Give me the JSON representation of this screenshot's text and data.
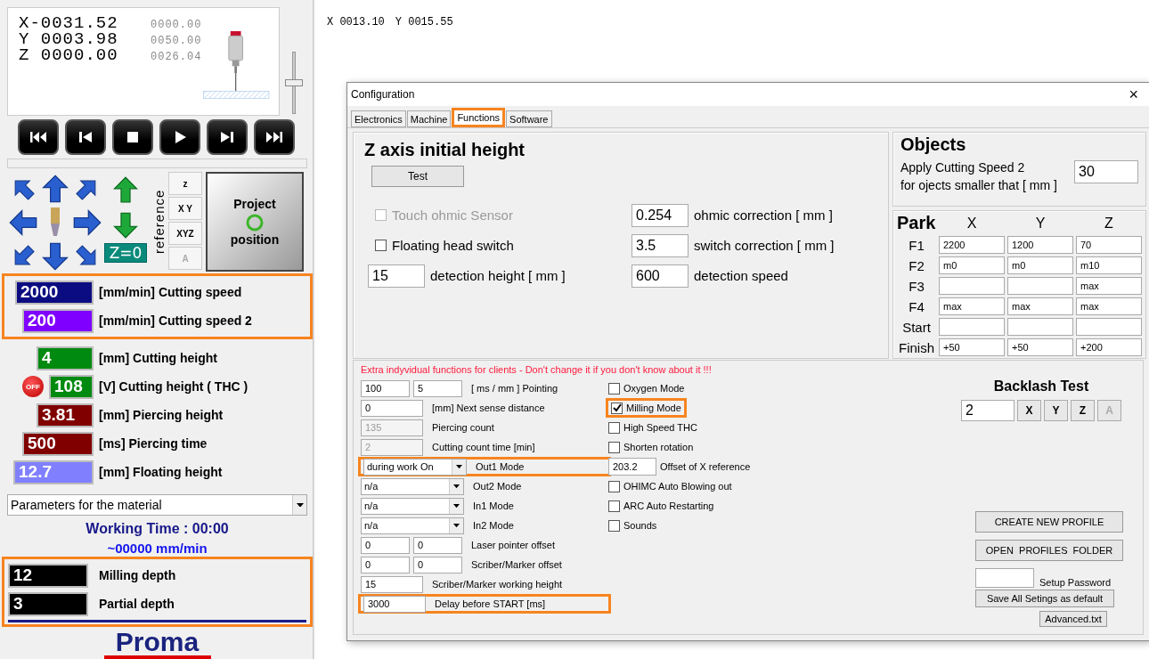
{
  "dro": {
    "axes": [
      {
        "position": "X-0031.52",
        "machine": "0000.00"
      },
      {
        "position": "Y 0003.98",
        "machine": "0050.00"
      },
      {
        "position": "Z 0000.00",
        "machine": "0026.04"
      }
    ]
  },
  "feed_slider": {
    "level": 0.5
  },
  "progress": {
    "level": 0
  },
  "jog": {
    "zero_button": "Z=0",
    "reference_label": "reference",
    "reference_buttons": [
      {
        "label": "z",
        "disabled": false
      },
      {
        "label": "X Y",
        "disabled": false
      },
      {
        "label": "XYZ",
        "disabled": false
      },
      {
        "label": "A",
        "disabled": true
      }
    ],
    "project_button": "Project position"
  },
  "parameter_groups": [
    {
      "highlighted": true,
      "rows": [
        {
          "value": "2000",
          "label": "[mm/min] Cutting speed",
          "color": "#0c0c82"
        },
        {
          "value": "200",
          "label": "[mm/min] Cutting speed 2",
          "color": "#8000ff"
        }
      ]
    },
    {
      "highlighted": false,
      "rows": [
        {
          "value": "4",
          "label": "[mm] Cutting height",
          "color": "#008a10"
        },
        {
          "value": "108",
          "label": "[V] Cutting height ( THC )",
          "color": "#008a10",
          "badge": "OFF"
        },
        {
          "value": "3.81",
          "label": "[mm] Piercing height",
          "color": "#800000"
        },
        {
          "value": "500",
          "label": "[ms] Piercing time",
          "color": "#800000"
        },
        {
          "value": "12.7",
          "label": "[mm] Floating height",
          "color": "#8080ff"
        }
      ]
    }
  ],
  "material_dropdown": "Parameters for the material",
  "working_time": "Working Time : 00:00",
  "speed_estimate": "~00000 mm/min",
  "depth_group": {
    "highlighted": true,
    "rows": [
      {
        "value": "12",
        "label": "Milling depth"
      },
      {
        "value": "3",
        "label": "Partial depth"
      }
    ]
  },
  "logo": "Proma",
  "canvas": {
    "coordinates": [
      "X 0013.10",
      "Y 0015.55"
    ]
  },
  "dialog": {
    "title": "Configuration",
    "close": "×",
    "tabs": [
      {
        "label": "Electronics",
        "selected": false,
        "highlighted": false
      },
      {
        "label": "Machine",
        "selected": false,
        "highlighted": false
      },
      {
        "label": "Functions",
        "selected": true,
        "highlighted": true
      },
      {
        "label": "Software",
        "selected": false,
        "highlighted": false
      }
    ],
    "z_axis": {
      "title": "Z axis initial height",
      "test_button": "Test",
      "checkboxes": [
        {
          "label": "Touch ohmic Sensor",
          "checked": false,
          "disabled": true
        },
        {
          "label": "Floating head switch",
          "checked": false,
          "disabled": false
        }
      ],
      "fields": [
        {
          "value": "0.254",
          "label": "ohmic correction [ mm ]"
        },
        {
          "value": "3.5",
          "label": "switch correction [ mm ]"
        },
        {
          "value": "15",
          "label": "detection height [ mm ]"
        },
        {
          "value": "600",
          "label": "detection speed"
        }
      ]
    },
    "objects": {
      "title": "Objects",
      "lines": [
        "Apply Cutting Speed 2",
        "for ojects smaller that [ mm ]"
      ],
      "value": "30"
    },
    "park": {
      "title": "Park",
      "columns": [
        "X",
        "Y",
        "Z"
      ],
      "rows": [
        {
          "label": "F1",
          "cells": [
            {
              "value": "2200"
            },
            {
              "value": "1200"
            },
            {
              "value": "70"
            }
          ]
        },
        {
          "label": "F2",
          "cells": [
            {
              "value": "m0"
            },
            {
              "value": "m0"
            },
            {
              "value": "m10"
            }
          ]
        },
        {
          "label": "F3",
          "cells": [
            {},
            {},
            {
              "value": "max"
            }
          ]
        },
        {
          "label": "F4",
          "cells": [
            {
              "value": "max"
            },
            {
              "value": "max"
            },
            {
              "value": "max"
            }
          ]
        },
        {
          "label": "Start",
          "cells": [
            {},
            {},
            {}
          ]
        },
        {
          "label": "Finish",
          "cells": [
            {
              "value": "+50"
            },
            {
              "value": "+50"
            },
            {
              "value": "+200"
            }
          ]
        }
      ]
    },
    "warning": "Extra indyvidual functions for clients - Don't change it if you don't know about it !!!",
    "extra_rows": [
      {
        "kind": "inputs",
        "values": [
          "100",
          "5"
        ],
        "label": "[ ms / mm ] Pointing",
        "disabled": false,
        "highlighted": false
      },
      {
        "kind": "inputs",
        "values": [
          "0"
        ],
        "label": "[mm] Next sense distance",
        "disabled": false,
        "highlighted": false
      },
      {
        "kind": "inputs",
        "values": [
          "135"
        ],
        "label": "Piercing count",
        "disabled": true,
        "highlighted": false
      },
      {
        "kind": "inputs",
        "values": [
          "2"
        ],
        "label": "Cutting count time [min]",
        "disabled": true,
        "highlighted": false
      },
      {
        "kind": "select",
        "values": [
          "during work On"
        ],
        "label": "Out1 Mode",
        "disabled": false,
        "highlighted": true
      },
      {
        "kind": "select",
        "values": [
          "n/a"
        ],
        "label": "Out2 Mode",
        "disabled": false,
        "highlighted": false
      },
      {
        "kind": "select",
        "values": [
          "n/a"
        ],
        "label": "In1 Mode",
        "disabled": false,
        "highlighted": false
      },
      {
        "kind": "select",
        "values": [
          "n/a"
        ],
        "label": "In2 Mode",
        "disabled": false,
        "highlighted": false
      },
      {
        "kind": "inputs",
        "values": [
          "0",
          "0"
        ],
        "label": "Laser pointer offset",
        "disabled": false,
        "highlighted": false
      },
      {
        "kind": "inputs",
        "values": [
          "0",
          "0"
        ],
        "label": "Scriber/Marker offset",
        "disabled": false,
        "highlighted": false
      },
      {
        "kind": "inputs",
        "values": [
          "15"
        ],
        "label": "Scriber/Marker working height",
        "disabled": false,
        "highlighted": false
      },
      {
        "kind": "inputs",
        "values": [
          "3000"
        ],
        "label": "Delay before START [ms]",
        "disabled": false,
        "highlighted": true
      }
    ],
    "options": [
      {
        "kind": "checkbox",
        "label": "Oxygen Mode",
        "checked": false,
        "highlighted": false
      },
      {
        "kind": "checkbox",
        "label": "Milling Mode",
        "checked": true,
        "highlighted": true
      },
      {
        "kind": "checkbox",
        "label": "High Speed THC",
        "checked": false,
        "highlighted": false
      },
      {
        "kind": "checkbox",
        "label": "Shorten rotation",
        "checked": false,
        "highlighted": false
      },
      {
        "kind": "field",
        "value": "203.2",
        "label": "Offset of X reference",
        "highlighted": false
      },
      {
        "kind": "checkbox",
        "label": "OHIMC Auto Blowing out",
        "checked": false,
        "highlighted": false
      },
      {
        "kind": "checkbox",
        "label": "ARC Auto Restarting",
        "checked": false,
        "highlighted": false
      },
      {
        "kind": "checkbox",
        "label": "Sounds",
        "checked": false,
        "highlighted": false
      }
    ],
    "backlash": {
      "title": "Backlash Test",
      "value": "2",
      "axes": [
        {
          "label": "X",
          "disabled": false
        },
        {
          "label": "Y",
          "disabled": false
        },
        {
          "label": "Z",
          "disabled": false
        },
        {
          "label": "A",
          "disabled": true
        }
      ]
    },
    "profile_buttons": [
      "CREATE NEW PROFILE",
      "OPEN  PROFILES  FOLDER"
    ],
    "password_label": "Setup Password",
    "save_button": "Save All Setings as default",
    "advanced_button": "Advanced.txt"
  }
}
